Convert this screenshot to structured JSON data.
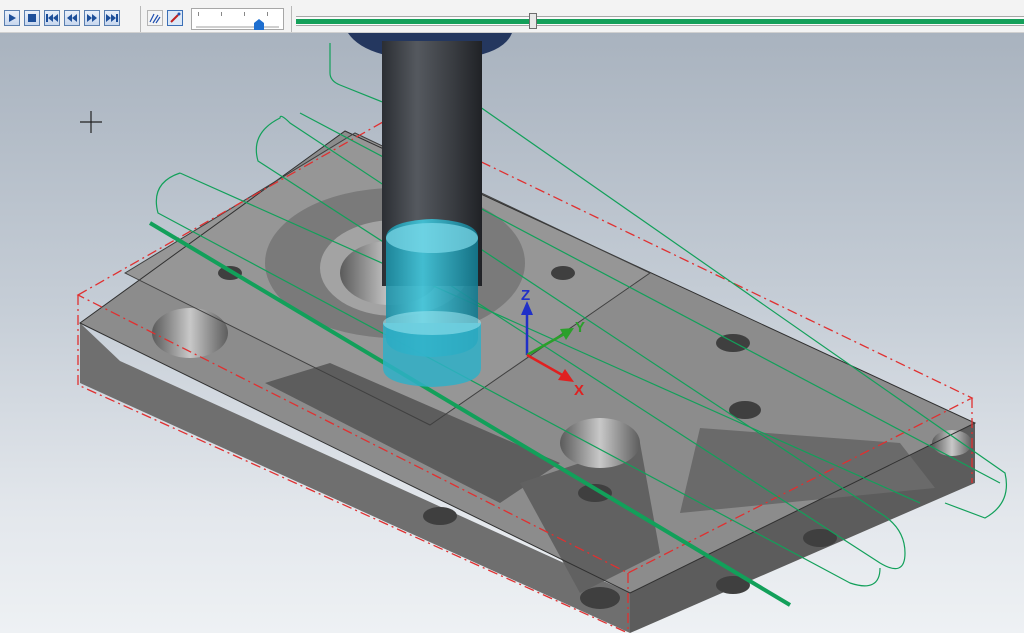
{
  "toolbar": {
    "buttons": [
      {
        "name": "play-button",
        "icon": "play-icon"
      },
      {
        "name": "stop-button",
        "icon": "stop-icon"
      },
      {
        "name": "skip-to-start-button",
        "icon": "skip-start-icon"
      },
      {
        "name": "step-back-button",
        "icon": "rewind-icon"
      },
      {
        "name": "step-forward-button",
        "icon": "fast-forward-icon"
      },
      {
        "name": "skip-to-end-button",
        "icon": "skip-end-icon"
      },
      {
        "name": "toolpath-display-button",
        "icon": "toolpath-icon"
      },
      {
        "name": "tool-display-button",
        "icon": "tool-icon",
        "active": true
      }
    ],
    "speed_slider": {
      "value": 0.8
    },
    "playback_progress": {
      "value": 0.325
    }
  },
  "viewport": {
    "triad": {
      "x_label": "X",
      "y_label": "Y",
      "z_label": "Z"
    },
    "colors": {
      "part": "#8f8f8f",
      "toolpath": "#12a05a",
      "stock_outline": "#e03030",
      "tool_holder": "#3a3d42",
      "cutter": "#2ab7cf",
      "x_axis": "#e02020",
      "y_axis": "#2aa02a",
      "z_axis": "#2030c8"
    }
  }
}
